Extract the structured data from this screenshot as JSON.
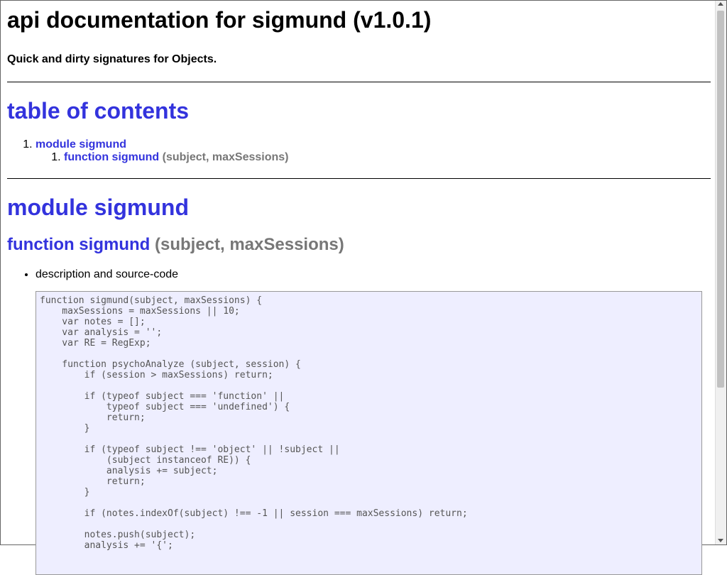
{
  "header": {
    "title": "api documentation for sigmund (v1.0.1)",
    "subtitle": "Quick and dirty signatures for Objects."
  },
  "toc": {
    "heading": "table of contents",
    "module_link": "module sigmund",
    "function_link": "function sigmund",
    "function_sig": "(subject, maxSessions)"
  },
  "module": {
    "heading": "module sigmund",
    "function_name": "function sigmund",
    "function_sig": "(subject, maxSessions)",
    "desc_item": "description and source-code",
    "code": "function sigmund(subject, maxSessions) {\n    maxSessions = maxSessions || 10;\n    var notes = [];\n    var analysis = '';\n    var RE = RegExp;\n\n    function psychoAnalyze (subject, session) {\n        if (session > maxSessions) return;\n\n        if (typeof subject === 'function' ||\n            typeof subject === 'undefined') {\n            return;\n        }\n\n        if (typeof subject !== 'object' || !subject ||\n            (subject instanceof RE)) {\n            analysis += subject;\n            return;\n        }\n\n        if (notes.indexOf(subject) !== -1 || session === maxSessions) return;\n\n        notes.push(subject);\n        analysis += '{';"
  },
  "colors": {
    "link": "#3333dd",
    "signature": "#777777",
    "code_bg": "#eeeeff"
  }
}
